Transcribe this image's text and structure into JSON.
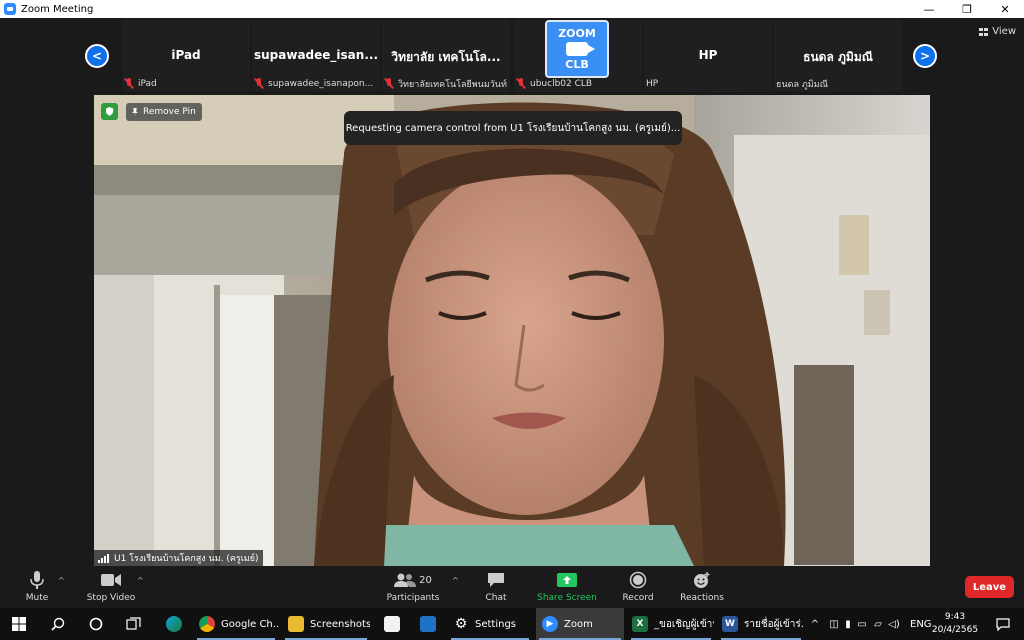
{
  "window": {
    "title": "Zoom Meeting",
    "minimize": "—",
    "restore": "❐",
    "close": "✕"
  },
  "view_button": {
    "label": "View",
    "icon": "grid-icon"
  },
  "gallery": {
    "thumbnails": [
      {
        "name": "iPad",
        "label": "iPad"
      },
      {
        "name": "supawadee_isan...",
        "label": "supawadee_isanapon..."
      },
      {
        "name": "วิทยาลัย เทคโนโล...",
        "label": "วิทยาลัยเทคโนโลยีพนมวันท์"
      },
      {
        "name": "",
        "label": "ubuclb02 CLB",
        "logo_text_top": "ZOOM",
        "logo_text_bottom": "CLB"
      },
      {
        "name": "HP",
        "label": "HP"
      },
      {
        "name": "ธนดล ภูมิมณี",
        "label": "ธนดล ภูมิมณี"
      }
    ]
  },
  "main_video": {
    "remove_pin_label": "Remove Pin",
    "toast_text": "Requesting camera control from U1 โรงเรียนบ้านโคกสูง นม. (ครูเมย์)...",
    "speaker_label": "U1 โรงเรียนบ้านโคกสูง นม. (ครูเมย์)"
  },
  "toolbar": {
    "mute_label": "Mute",
    "stop_video_label": "Stop Video",
    "participants_label": "Participants",
    "participants_count": "20",
    "chat_label": "Chat",
    "share_screen_label": "Share Screen",
    "record_label": "Record",
    "reactions_label": "Reactions",
    "leave_label": "Leave",
    "caret": "^"
  },
  "taskbar": {
    "items": [
      {
        "label": "Google Ch..."
      },
      {
        "label": "Screenshots"
      },
      {
        "label": "Settings"
      },
      {
        "label": "Zoom"
      },
      {
        "label": "_ขอเชิญผู้เข้าร่..."
      },
      {
        "label": "รายชื่อผู้เข้าร่..."
      }
    ],
    "language": "ENG",
    "time": "9:43",
    "date": "20/4/2565"
  },
  "colors": {
    "accent_blue": "#0e71eb",
    "leave_red": "#e02828",
    "share_green": "#22c55e",
    "muted_red": "#e0303a"
  }
}
